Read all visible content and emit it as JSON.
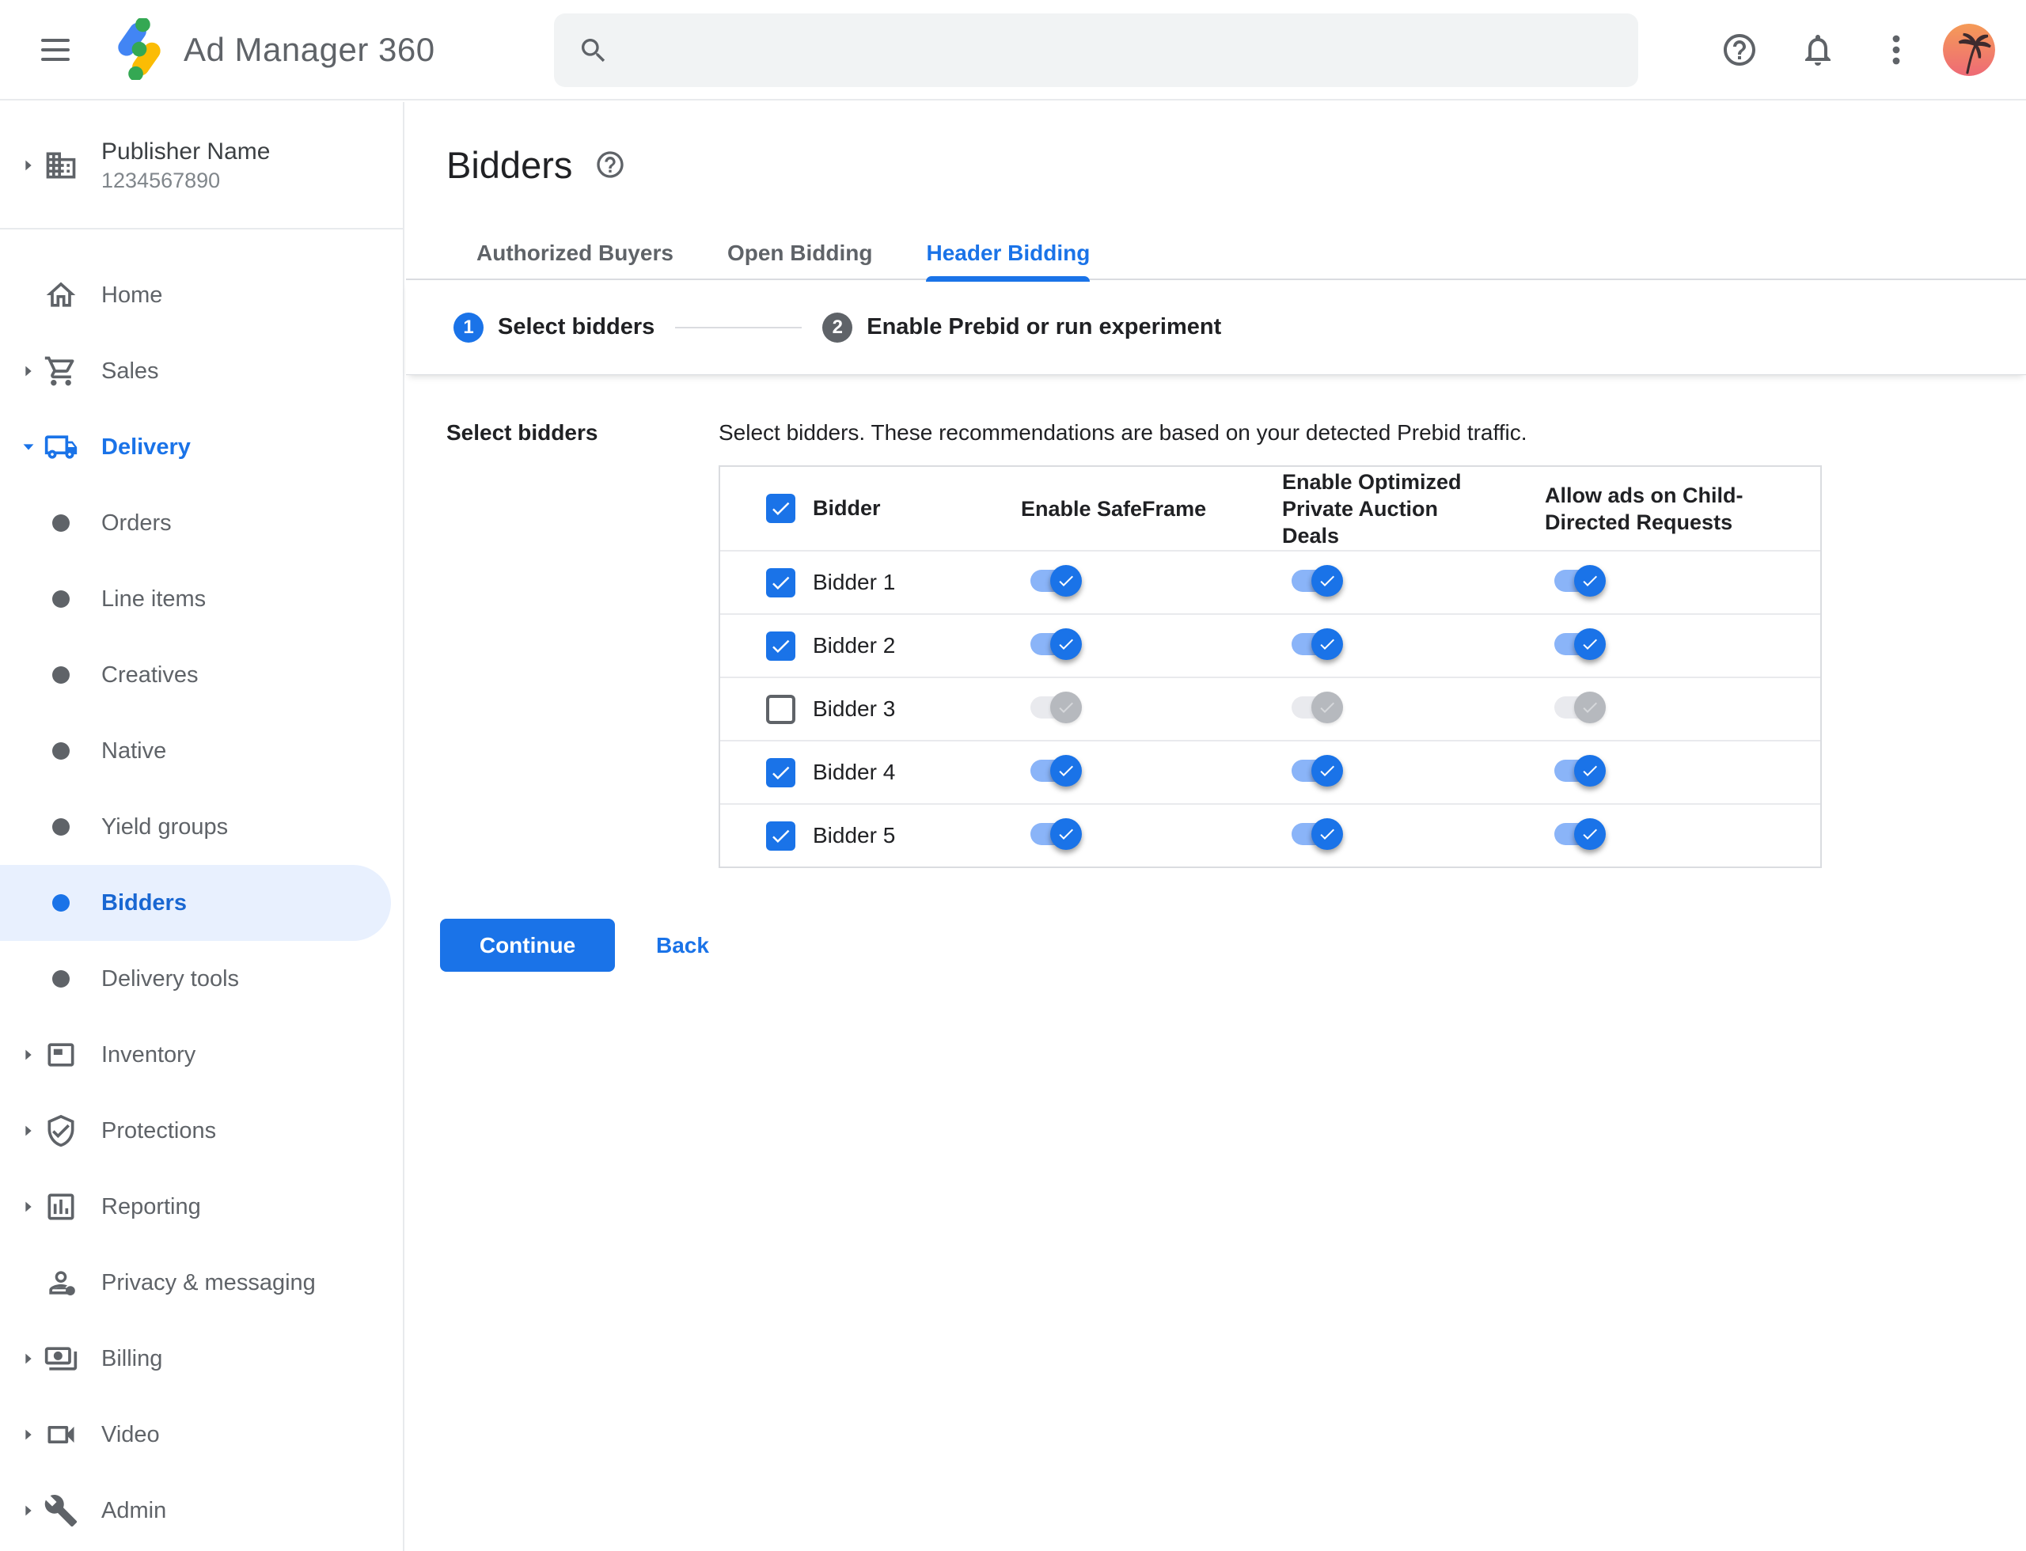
{
  "header": {
    "app_title": "Ad Manager 360",
    "search_placeholder": "",
    "search_value": ""
  },
  "account": {
    "name": "Publisher Name",
    "id": "1234567890"
  },
  "sidebar": {
    "items": [
      {
        "label": "Home",
        "icon": "home-icon",
        "level": "top",
        "caret": "none"
      },
      {
        "label": "Sales",
        "icon": "cart-icon",
        "level": "top",
        "caret": "collapsed"
      },
      {
        "label": "Delivery",
        "icon": "truck-icon",
        "level": "top",
        "caret": "expanded",
        "expanded_parent": true
      },
      {
        "label": "Orders",
        "icon": "dot-icon",
        "level": "sub",
        "caret": "none"
      },
      {
        "label": "Line items",
        "icon": "dot-icon",
        "level": "sub",
        "caret": "none"
      },
      {
        "label": "Creatives",
        "icon": "dot-icon",
        "level": "sub",
        "caret": "none"
      },
      {
        "label": "Native",
        "icon": "dot-icon",
        "level": "sub",
        "caret": "none"
      },
      {
        "label": "Yield groups",
        "icon": "dot-icon",
        "level": "sub",
        "caret": "none"
      },
      {
        "label": "Bidders",
        "icon": "dot-icon",
        "level": "sub",
        "caret": "none",
        "selected": true
      },
      {
        "label": "Delivery tools",
        "icon": "dot-icon",
        "level": "sub",
        "caret": "none"
      },
      {
        "label": "Inventory",
        "icon": "adunit-icon",
        "level": "top",
        "caret": "collapsed"
      },
      {
        "label": "Protections",
        "icon": "shield-check-icon",
        "level": "top",
        "caret": "collapsed"
      },
      {
        "label": "Reporting",
        "icon": "bar-chart-icon",
        "level": "top",
        "caret": "collapsed"
      },
      {
        "label": "Privacy & messaging",
        "icon": "privacy-person-icon",
        "level": "top",
        "caret": "none"
      },
      {
        "label": "Billing",
        "icon": "banknote-icon",
        "level": "top",
        "caret": "collapsed"
      },
      {
        "label": "Video",
        "icon": "videocam-icon",
        "level": "top",
        "caret": "collapsed"
      },
      {
        "label": "Admin",
        "icon": "wrench-icon",
        "level": "top",
        "caret": "collapsed"
      }
    ]
  },
  "page": {
    "title": "Bidders"
  },
  "tabs": [
    {
      "label": "Authorized Buyers",
      "active": false
    },
    {
      "label": "Open Bidding",
      "active": false
    },
    {
      "label": "Header Bidding",
      "active": true
    }
  ],
  "stepper": [
    {
      "number": "1",
      "label": "Select bidders",
      "active": true
    },
    {
      "number": "2",
      "label": "Enable Prebid or run experiment",
      "active": false
    }
  ],
  "content": {
    "section_label": "Select bidders",
    "description": "Select bidders. These recommendations are based on your detected Prebid traffic.",
    "table": {
      "select_all_checked": true,
      "columns": [
        "Bidder",
        "Enable SafeFrame",
        "Enable Optimized Private Auction Deals",
        "Allow ads on Child-Directed Requests"
      ],
      "rows": [
        {
          "name": "Bidder 1",
          "selected": true,
          "enable_safeframe": true,
          "enable_optimized_private_auction_deals": true,
          "allow_ads_child_directed": true
        },
        {
          "name": "Bidder 2",
          "selected": true,
          "enable_safeframe": true,
          "enable_optimized_private_auction_deals": true,
          "allow_ads_child_directed": true
        },
        {
          "name": "Bidder 3",
          "selected": false,
          "enable_safeframe": false,
          "enable_optimized_private_auction_deals": false,
          "allow_ads_child_directed": false
        },
        {
          "name": "Bidder 4",
          "selected": true,
          "enable_safeframe": true,
          "enable_optimized_private_auction_deals": true,
          "allow_ads_child_directed": true
        },
        {
          "name": "Bidder 5",
          "selected": true,
          "enable_safeframe": true,
          "enable_optimized_private_auction_deals": true,
          "allow_ads_child_directed": true
        }
      ]
    },
    "continue_label": "Continue",
    "back_label": "Back"
  },
  "colors": {
    "accent_blue": "#1a73e8",
    "selected_nav_text": "#1967d2",
    "selected_nav_bg": "#e8f0fe",
    "toggle_track_on": "#8ab4f8",
    "toggle_track_off": "#e9eaee",
    "toggle_thumb_off": "#b6b9be",
    "logo_blue": "#4285f4",
    "logo_yellow": "#fbbc04",
    "logo_green": "#34a853",
    "icon_gray": "#5f6368"
  }
}
